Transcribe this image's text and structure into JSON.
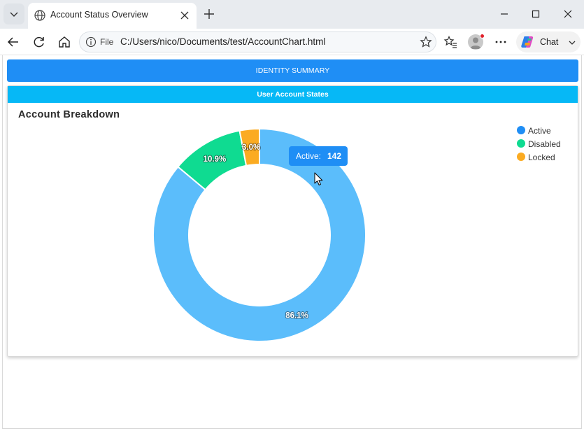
{
  "browser": {
    "tab_title": "Account Status Overview",
    "omnibox_scheme": "File",
    "url": "C:/Users/nico/Documents/test/AccountChart.html",
    "chat_label": "Chat"
  },
  "page": {
    "identity_bar": "IDENTITY SUMMARY",
    "card_header": "User Account States",
    "chart_title": "Account Breakdown"
  },
  "tooltip": {
    "label": "Active:",
    "value": "142"
  },
  "colors": {
    "accent_blue": "#1f8ef5",
    "header_cyan": "#06b8f6",
    "active": "#5bbdfb",
    "disabled": "#0fdb91",
    "locked": "#fbab22"
  },
  "chart_data": {
    "type": "pie",
    "style": "doughnut",
    "title": "Account Breakdown",
    "legend": "top-right",
    "categories": [
      "Active",
      "Disabled",
      "Locked"
    ],
    "values": [
      86.1,
      10.9,
      3.0
    ],
    "data_labels": [
      "86.1%",
      "10.9%",
      "3.0%"
    ],
    "colors": [
      "#5bbdfb",
      "#0fdb91",
      "#fbab22"
    ],
    "legend_colors": [
      "#1f8ef5",
      "#0fdb91",
      "#fbab22"
    ]
  }
}
